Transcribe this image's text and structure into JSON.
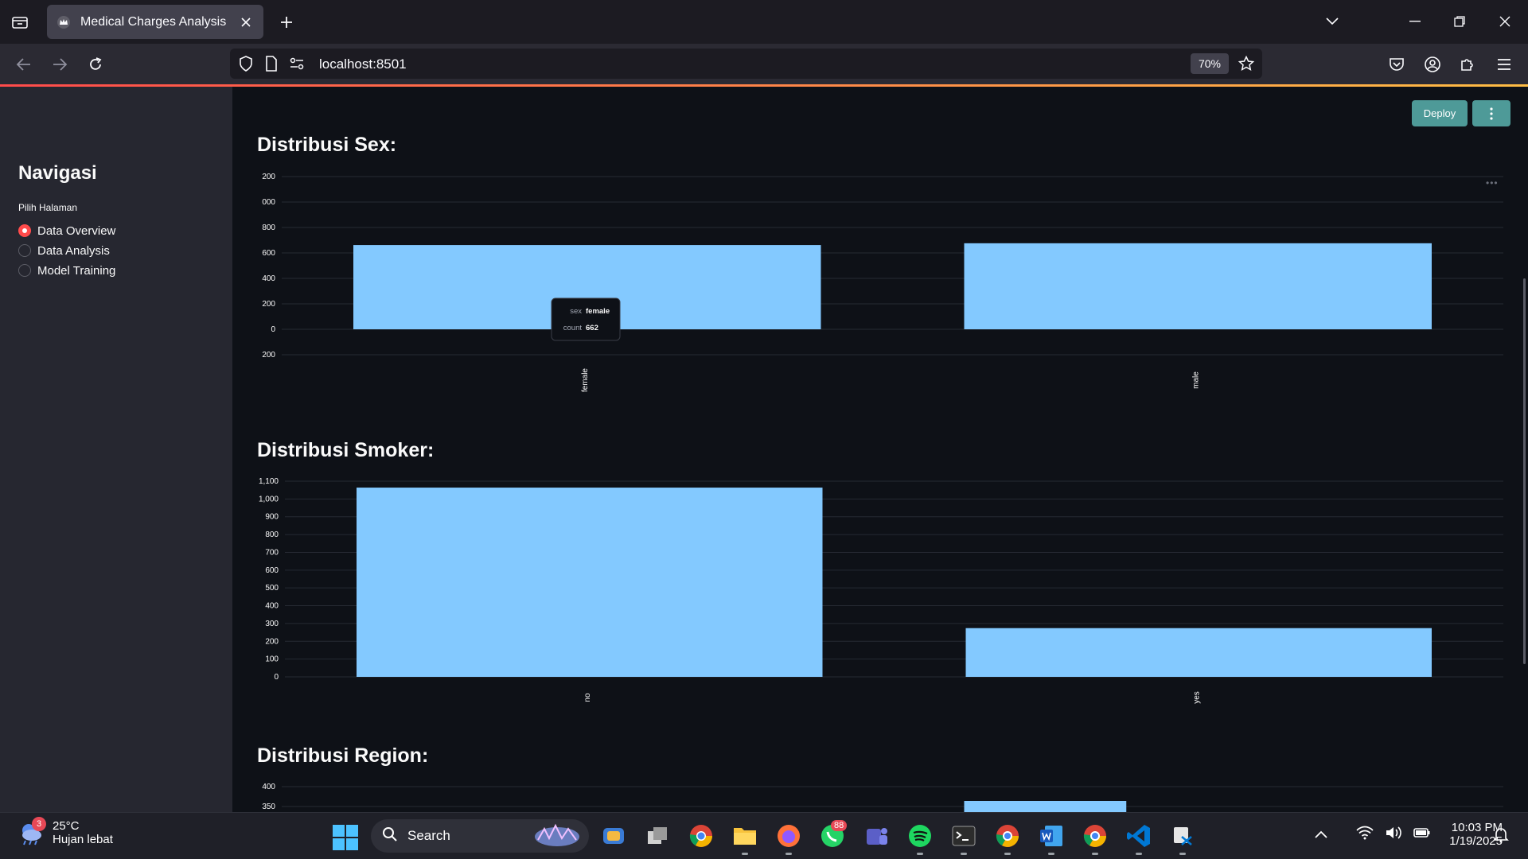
{
  "browser": {
    "tab_title": "Medical Charges Analysis",
    "url": "localhost:8501",
    "zoom": "70%"
  },
  "sidebar": {
    "title": "Navigasi",
    "radio_label": "Pilih Halaman",
    "options": [
      {
        "label": "Data Overview",
        "selected": true
      },
      {
        "label": "Data Analysis",
        "selected": false
      },
      {
        "label": "Model Training",
        "selected": false
      }
    ]
  },
  "toolbar": {
    "deploy_label": "Deploy"
  },
  "sections": {
    "sex_title": "Distribusi Sex:",
    "smoker_title": "Distribusi Smoker:",
    "region_title": "Distribusi Region:"
  },
  "tooltip": {
    "field1_key": "sex",
    "field1_value": "female",
    "field2_key": "count",
    "field2_value": "662"
  },
  "chart_data": [
    {
      "type": "bar",
      "categories": [
        "female",
        "male"
      ],
      "values": [
        662,
        676
      ],
      "ylim": [
        -200,
        1200
      ],
      "ytick_labels": [
        "200",
        "000",
        "800",
        "600",
        "400",
        "200",
        "0",
        "200"
      ],
      "ytick_values": [
        1200,
        1000,
        800,
        600,
        400,
        200,
        0,
        -200
      ],
      "bar_color": "#83c9ff",
      "grid": true
    },
    {
      "type": "bar",
      "categories": [
        "no",
        "yes"
      ],
      "values": [
        1064,
        274
      ],
      "ylim": [
        0,
        1100
      ],
      "ytick_labels": [
        "1,100",
        "1,000",
        "900",
        "800",
        "700",
        "600",
        "500",
        "400",
        "300",
        "200",
        "100",
        "0"
      ],
      "ytick_values": [
        1100,
        1000,
        900,
        800,
        700,
        600,
        500,
        400,
        300,
        200,
        100,
        0
      ],
      "bar_color": "#83c9ff",
      "grid": true
    },
    {
      "type": "bar",
      "categories": [
        "",
        "",
        "",
        ""
      ],
      "values": [
        0,
        0,
        364,
        0
      ],
      "ylim": [
        0,
        400
      ],
      "ytick_labels": [
        "400",
        "350"
      ],
      "ytick_values": [
        400,
        350
      ],
      "bar_color": "#83c9ff",
      "grid": true
    }
  ],
  "taskbar": {
    "weather_temp": "25°C",
    "weather_desc": "Hujan lebat",
    "weather_badge": "3",
    "search_label": "Search",
    "whatsapp_badge": "88",
    "time": "10:03 PM",
    "date": "1/19/2025"
  }
}
